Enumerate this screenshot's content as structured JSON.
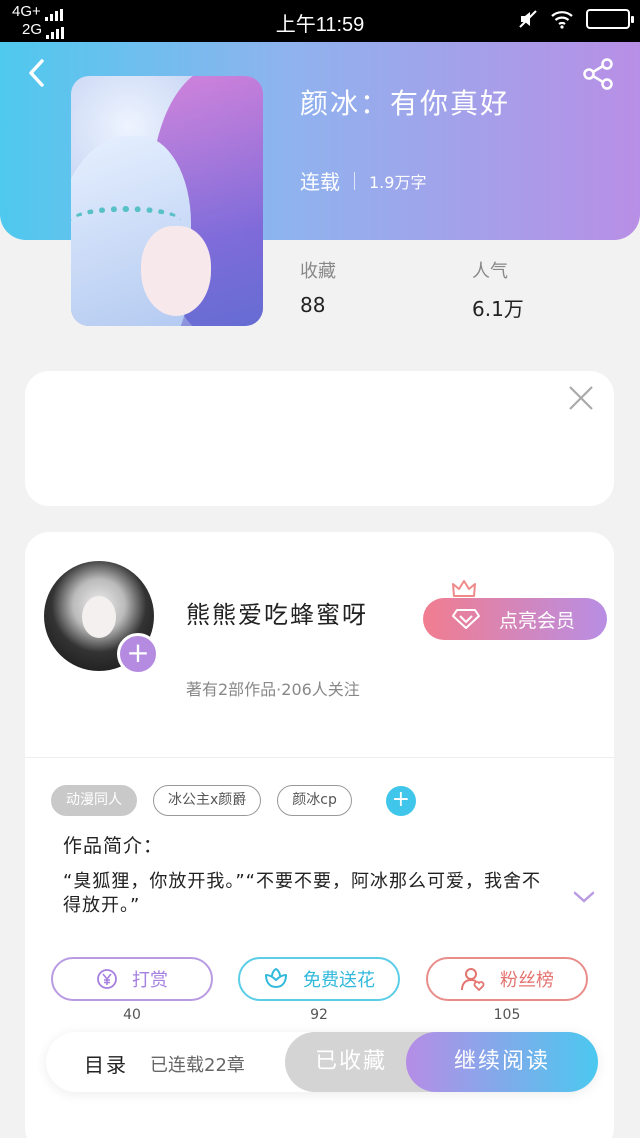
{
  "status_bar": {
    "network_top": "4G+",
    "network_bottom": "2G",
    "time": "上午11:59"
  },
  "book": {
    "title": "颜冰：有你真好",
    "status": "连载",
    "word_count": "1.9万字",
    "favorites_label": "收藏",
    "favorites_value": "88",
    "popularity_label": "人气",
    "popularity_value": "6.1万"
  },
  "author": {
    "name": "熊熊爱吃蜂蜜呀",
    "meta": "著有2部作品·206人关注",
    "vip_label": "点亮会员"
  },
  "tags": [
    "动漫同人",
    "冰公主x颜爵",
    "颜冰cp"
  ],
  "intro": {
    "title": "作品简介：",
    "text": "“臭狐狸，你放开我。”“不要不要，阿冰那么可爱，我舍不得放开。”"
  },
  "actions": {
    "tip_label": "打赏",
    "tip_count": "40",
    "flower_label": "免费送花",
    "flower_count": "92",
    "fans_label": "粉丝榜",
    "fans_count": "105"
  },
  "bottom": {
    "catalog_label": "目录",
    "chapter_info": "已连载22章",
    "collected_label": "已收藏",
    "read_label": "继续阅读"
  },
  "colors": {
    "header_gradient_start": "#4fc9ee",
    "header_gradient_end": "#b88fe6",
    "vip_gradient_start": "#f17d8f",
    "tag_add": "#3fc6ea"
  },
  "icons": [
    "back-arrow-icon",
    "share-icon",
    "close-icon",
    "diamond-icon",
    "crown-icon",
    "yen-icon",
    "flower-icon",
    "person-heart-icon",
    "chevron-down-icon",
    "plus-icon"
  ]
}
